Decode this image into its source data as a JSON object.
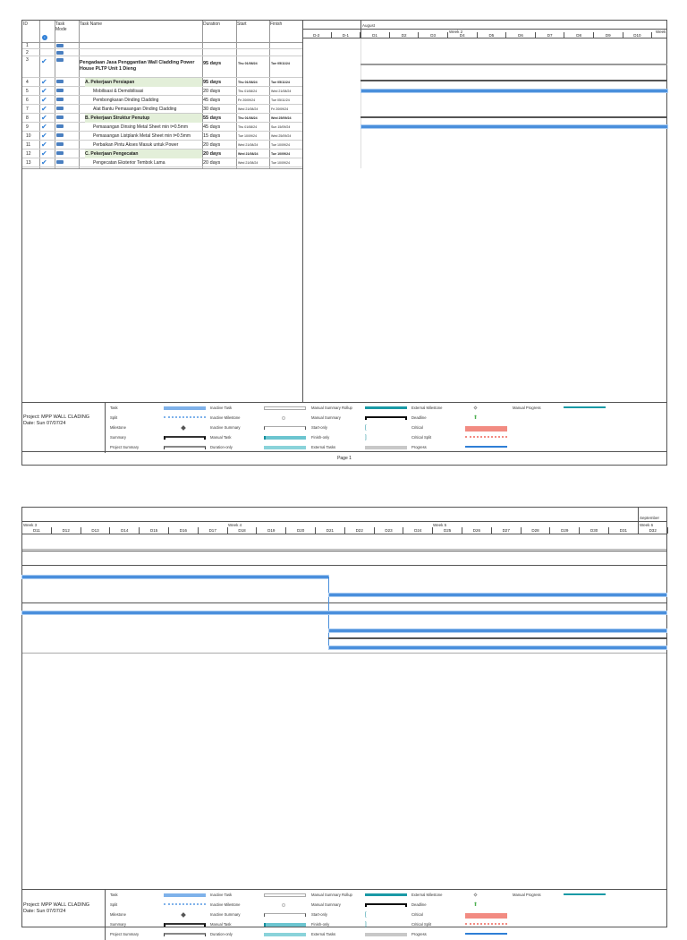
{
  "columns": {
    "id": "ID",
    "mode": "Task Mode",
    "name": "Task Name",
    "duration": "Duration",
    "start": "Start",
    "finish": "Finish"
  },
  "tasks": [
    {
      "id": "1",
      "name": "",
      "duration": "",
      "start": "",
      "finish": "",
      "done": false,
      "summary": false
    },
    {
      "id": "2",
      "name": "",
      "duration": "",
      "start": "",
      "finish": "",
      "done": false,
      "summary": false
    },
    {
      "id": "3",
      "name": "Pengadaan Jasa Penggantian Wall Cladding Power House PLTP Unit 1 Dieng",
      "duration": "95 days",
      "start": "Thu 01/08/24",
      "finish": "Tue 05/11/24",
      "done": true,
      "summary": true,
      "project": true
    },
    {
      "id": "4",
      "name": "A. Pekerjaan Persiapan",
      "duration": "95 days",
      "start": "Thu 01/08/24",
      "finish": "Tue 05/11/24",
      "done": true,
      "summary": true
    },
    {
      "id": "5",
      "name": "Mobilisasi & Demobilisasi",
      "duration": "20 days",
      "start": "Thu 01/08/24",
      "finish": "Wed 21/08/24",
      "done": true,
      "summary": false
    },
    {
      "id": "6",
      "name": "Pembongkaran Dinding Cladding",
      "duration": "45 days",
      "start": "Fri 20/09/24",
      "finish": "Tue 05/11/24",
      "done": true,
      "summary": false
    },
    {
      "id": "7",
      "name": "Alat Bantu Pemasangan Dinding Cladding",
      "duration": "30 days",
      "start": "Wed 21/08/24",
      "finish": "Fri 20/09/24",
      "done": true,
      "summary": false
    },
    {
      "id": "8",
      "name": "B. Pekerjaan Struktur Penutup",
      "duration": "55 days",
      "start": "Thu 01/08/24",
      "finish": "Wed 25/09/24",
      "done": true,
      "summary": true
    },
    {
      "id": "9",
      "name": "Pemasangan Dinsing Metal Sheet min t=0.5mm",
      "duration": "45 days",
      "start": "Thu 01/08/24",
      "finish": "Sun 15/09/24",
      "done": true,
      "summary": false
    },
    {
      "id": "10",
      "name": "Pemasangan Listplank Metal Sheet min t=0.5mm",
      "duration": "15 days",
      "start": "Tue 10/09/24",
      "finish": "Wed 25/09/24",
      "done": true,
      "summary": false
    },
    {
      "id": "11",
      "name": "Perbaikan Pintu Akses Masuk untuk Power",
      "duration": "20 days",
      "start": "Wed 21/08/24",
      "finish": "Tue 10/09/24",
      "done": true,
      "summary": false
    },
    {
      "id": "12",
      "name": "C. Pekerjaan Pengecatan",
      "duration": "20 days",
      "start": "Wed 21/08/24",
      "finish": "Tue 10/09/24",
      "done": true,
      "summary": true
    },
    {
      "id": "13",
      "name": "Pengecatan Eksterior Tembok Lama",
      "duration": "20 days",
      "start": "Wed 21/08/24",
      "finish": "Tue 10/09/24",
      "done": true,
      "summary": false
    }
  ],
  "timeline1": {
    "month": "August",
    "week": "Week 2",
    "week_next": "Week",
    "days": [
      "D-2",
      "D-1",
      "D1",
      "D2",
      "D3",
      "D4",
      "D5",
      "D6",
      "D7",
      "D8",
      "D9",
      "D10"
    ]
  },
  "timeline2": {
    "month": "September",
    "weeks": [
      "Week 3",
      "Week 4",
      "Week 5",
      "Week 6"
    ],
    "days": [
      "D11",
      "D12",
      "D13",
      "D14",
      "D15",
      "D16",
      "D17",
      "D18",
      "D19",
      "D20",
      "D21",
      "D22",
      "D23",
      "D24",
      "D25",
      "D26",
      "D27",
      "D28",
      "D29",
      "D30",
      "D31",
      "D32"
    ]
  },
  "legend": {
    "project": "Project: MPP WALL CLADING",
    "date": "Date: Sun 07/07/24",
    "items": [
      [
        "Task",
        "Split",
        "Milestone",
        "Summary",
        "Project Summary"
      ],
      [
        "Inactive Task",
        "Inactive Milestone",
        "Inactive Summary",
        "Manual Task",
        "Duration-only"
      ],
      [
        "Manual Summary Rollup",
        "Manual Summary",
        "Start-only",
        "Finish-only",
        "External Tasks"
      ],
      [
        "External Milestone",
        "Deadline",
        "Critical",
        "Critical Split",
        "Progress"
      ],
      [
        "Manual Progress"
      ]
    ]
  },
  "page_label": "Page 1"
}
